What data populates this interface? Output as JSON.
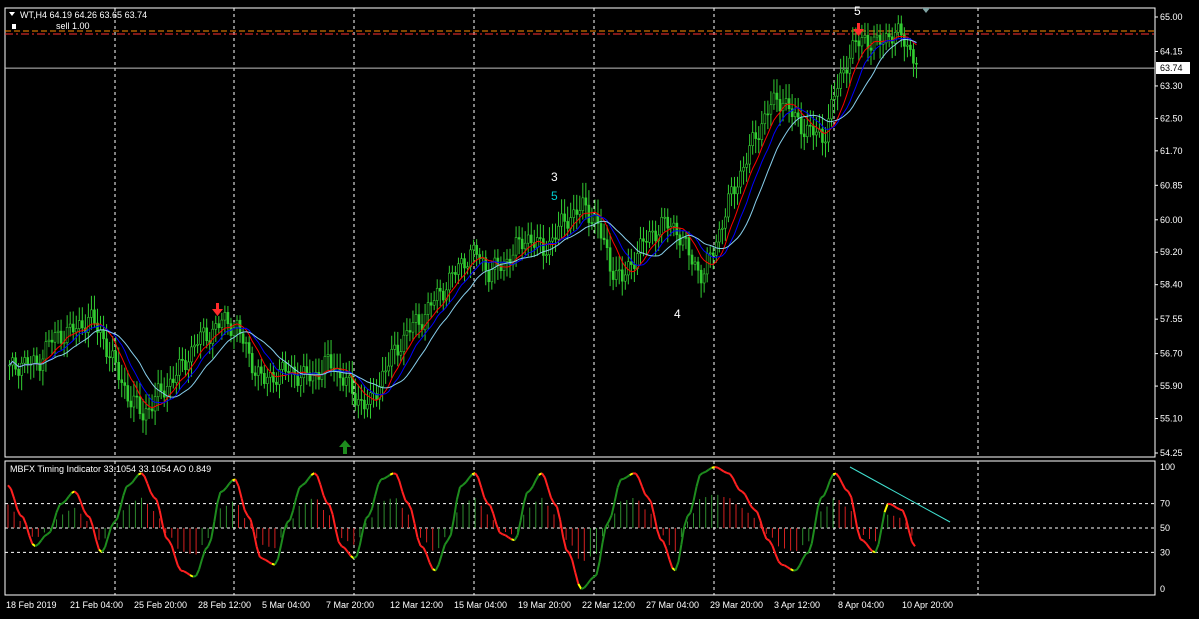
{
  "header": {
    "symbol_line": "WT,H4  64.19 64.26 63.65 63.74",
    "sell_label": "sell 1.00"
  },
  "price_axis": {
    "labels": [
      "65.00",
      "64.15",
      "63.30",
      "62.50",
      "61.70",
      "60.85",
      "60.00",
      "59.20",
      "58.40",
      "57.55",
      "56.70",
      "55.90",
      "55.10",
      "54.25"
    ],
    "current_price": "63.74"
  },
  "indicator": {
    "title": "MBFX Timing Indicator 33.1054 33.1054  AO 0.849",
    "levels": [
      "100",
      "70",
      "50",
      "30",
      "0"
    ]
  },
  "time_axis": {
    "labels": [
      "18 Feb 2019",
      "21 Feb 04:00",
      "25 Feb 20:00",
      "28 Feb 12:00",
      "5 Mar 04:00",
      "7 Mar 20:00",
      "12 Mar 12:00",
      "15 Mar 04:00",
      "19 Mar 20:00",
      "22 Mar 12:00",
      "27 Mar 04:00",
      "29 Mar 20:00",
      "3 Apr 12:00",
      "8 Apr 04:00",
      "10 Apr 20:00"
    ]
  },
  "wave_labels": {
    "w3": "3",
    "w5a": "5",
    "w4": "4",
    "w5b": "5"
  },
  "colors": {
    "bull": "#32cd32",
    "bear": "#ff2a2a",
    "ma_fast": "#ff0000",
    "ma_mid": "#0000ff",
    "ma_slow": "#87ceeb",
    "grid": "#ffffff",
    "level_line": "#ff8c00"
  },
  "chart_data": {
    "type": "candlestick",
    "price_ylim": [
      54.25,
      65.0
    ],
    "close_path": [
      56.3,
      56.5,
      56.4,
      57.0,
      57.2,
      57.3,
      57.6,
      57.1,
      56.3,
      55.6,
      55.2,
      55.6,
      56.0,
      56.4,
      57.0,
      57.2,
      57.5,
      57.4,
      56.6,
      56.0,
      56.2,
      56.3,
      56.1,
      56.2,
      56.5,
      56.1,
      55.6,
      55.4,
      56.2,
      56.8,
      57.3,
      57.6,
      58.1,
      58.5,
      59.0,
      59.2,
      58.7,
      58.9,
      59.3,
      59.6,
      59.2,
      59.7,
      60.1,
      60.3,
      60.0,
      58.9,
      58.5,
      59.2,
      59.6,
      59.9,
      59.8,
      59.1,
      58.6,
      59.5,
      60.5,
      61.3,
      62.1,
      62.8,
      63.0,
      62.4,
      62.2,
      62.0,
      63.2,
      64.1,
      64.5,
      64.3,
      64.6,
      64.5,
      63.9
    ],
    "indicator_ylim": [
      0,
      100
    ],
    "indicator_path": [
      85,
      60,
      35,
      45,
      70,
      80,
      60,
      30,
      55,
      85,
      95,
      75,
      40,
      15,
      10,
      35,
      80,
      90,
      60,
      25,
      20,
      55,
      85,
      95,
      70,
      35,
      25,
      60,
      90,
      95,
      70,
      35,
      15,
      40,
      85,
      95,
      70,
      45,
      40,
      80,
      95,
      70,
      30,
      0,
      10,
      55,
      90,
      95,
      75,
      40,
      15,
      60,
      95,
      100,
      95,
      80,
      65,
      40,
      20,
      15,
      30,
      75,
      95,
      80,
      40,
      30,
      70,
      65,
      35
    ]
  }
}
